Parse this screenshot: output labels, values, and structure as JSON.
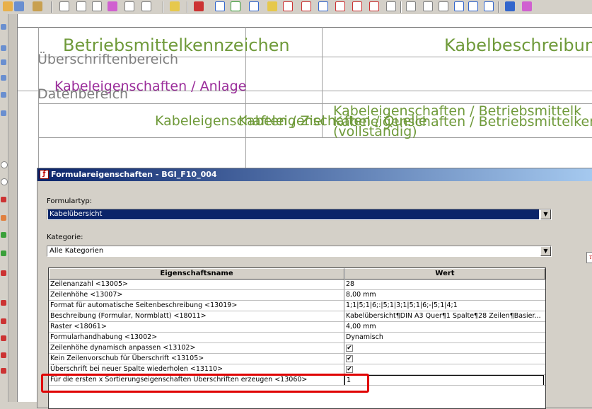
{
  "toolbar": {
    "icons": [
      "toolbar-icon",
      "toolbar-icon",
      "toolbar-icon",
      "toolbar-icon",
      "toolbar-icon"
    ],
    "colors": {
      "accent_red": "#cc3333",
      "accent_blue": "#3366cc",
      "accent_yellow": "#e6c84c"
    }
  },
  "canvas": {
    "header_betriebsmittel": "Betriebsmittelkennzeichen",
    "header_kabelbeschreibung": "Kabelbeschreibun",
    "section_ueberschrift": "Überschriftenbereich",
    "kabeleigenschaften_anlage": "Kabeleigenschaften / Anlage",
    "section_daten": "Datenbereich",
    "kabel_field_a": "Kabeleigenschaften / Ziel",
    "kabel_field_b": "Kabeleigenschaften / Quelle",
    "kabel_field_c1": "Kabeleigenschaften / Betriebsmittelk",
    "kabel_field_c2": "Kabeleigenschaften / Betriebsmittelkennzeichen (ide",
    "kabel_field_c3": "(vollständig)"
  },
  "dialog": {
    "title": "Formulareigenschaften - BGI_F10_004",
    "formulartyp_label": "Formulartyp:",
    "formulartyp_value": "Kabelübersicht",
    "kategorie_label": "Kategorie:",
    "kategorie_value": "Alle Kategorien",
    "grid": {
      "col_name": "Eigenschaftsname",
      "col_value": "Wert",
      "rows": [
        {
          "name": "Zeilenanzahl <13005>",
          "value": "28"
        },
        {
          "name": "Zeilenhöhe <13007>",
          "value": "8,00 mm"
        },
        {
          "name": "Format für automatische Seitenbeschreibung <13019>",
          "value": "1;1|5;1|6;:|5;1|3;1|5;1|6;-|5;1|4;1"
        },
        {
          "name": "Beschreibung (Formular, Normblatt) <18011>",
          "value": "Kabelübersicht¶DIN A3 Quer¶1 Spalte¶28 Zeilen¶Basier..."
        },
        {
          "name": "Raster <18061>",
          "value": "4,00 mm"
        },
        {
          "name": "Formularhandhabung <13002>",
          "value": "Dynamisch"
        },
        {
          "name": "Zeilenhöhe dynamisch anpassen <13102>",
          "value": "✔"
        },
        {
          "name": "Kein Zeilenvorschub für Überschrift <13105>",
          "value": "✔"
        },
        {
          "name": "Überschrift bei neuer Spalte wiederholen <13110>",
          "value": "✔"
        },
        {
          "name": "Für die ersten x Sortierungseigenschaften Überschriften erzeugen <13060>",
          "value": "1"
        }
      ]
    }
  }
}
